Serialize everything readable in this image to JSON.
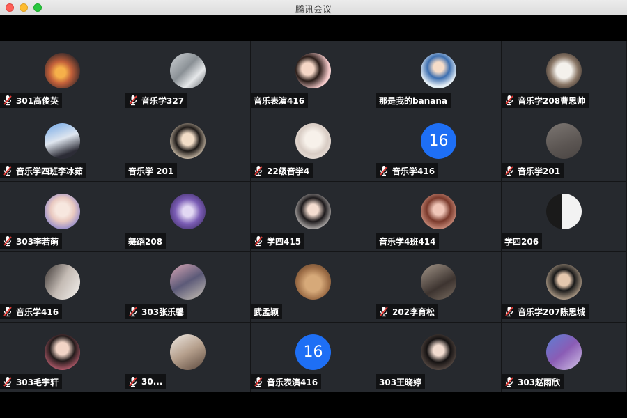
{
  "window": {
    "title": "腾讯会议"
  },
  "participants": [
    {
      "name": "301高俊英",
      "muted": true,
      "avatar": "photo-sunset"
    },
    {
      "name": "音乐学327",
      "muted": true,
      "avatar": "photo-robot"
    },
    {
      "name": "音乐表演416",
      "muted": false,
      "avatar": "photo-cartoon-pair"
    },
    {
      "name": "那是我的banana",
      "muted": false,
      "avatar": "photo-anime-girl-book"
    },
    {
      "name": "音乐学208曹思帅",
      "muted": true,
      "avatar": "photo-dog"
    },
    {
      "name": "音乐学四班李冰茹",
      "muted": true,
      "avatar": "photo-girl-blue-sky"
    },
    {
      "name": "音乐学 201",
      "muted": false,
      "avatar": "photo-girl-ears"
    },
    {
      "name": "22级音学4",
      "muted": true,
      "avatar": "photo-sketch-girl"
    },
    {
      "name": "音乐学416",
      "muted": true,
      "avatar": "16"
    },
    {
      "name": "音乐学201",
      "muted": true,
      "avatar": "photo-grey-couple"
    },
    {
      "name": "303李若萌",
      "muted": true,
      "avatar": "photo-anime-blonde"
    },
    {
      "name": "舞蹈208",
      "muted": false,
      "avatar": "photo-purple-anime"
    },
    {
      "name": "学四415",
      "muted": true,
      "avatar": "photo-anime-boy"
    },
    {
      "name": "音乐学4班414",
      "muted": false,
      "avatar": "photo-girl-sunglasses"
    },
    {
      "name": "学四206",
      "muted": false,
      "avatar": "photo-bw-silhouette"
    },
    {
      "name": "音乐学416",
      "muted": true,
      "avatar": "photo-boy-window"
    },
    {
      "name": "303张乐馨",
      "muted": true,
      "avatar": "photo-girl-costume"
    },
    {
      "name": "武孟颖",
      "muted": false,
      "avatar": "photo-teddy-bears"
    },
    {
      "name": "202李育松",
      "muted": true,
      "avatar": "photo-boy-piano"
    },
    {
      "name": "音乐学207陈思城",
      "muted": true,
      "avatar": "photo-man-sunglasses"
    },
    {
      "name": "303毛宇轩",
      "muted": true,
      "avatar": "photo-girl-pink"
    },
    {
      "name": "30...",
      "muted": true,
      "avatar": "photo-room-figure"
    },
    {
      "name": "音乐表演416",
      "muted": true,
      "avatar": "16"
    },
    {
      "name": "303王晓婷",
      "muted": false,
      "avatar": "photo-girl-dark-hair"
    },
    {
      "name": "303赵雨欣",
      "muted": true,
      "avatar": "photo-purple-bed"
    }
  ],
  "colors": {
    "tile_bg": "#26292e",
    "number_avatar_bg": "#1e6ff5",
    "mute_icon": "#ffffff",
    "mute_slash": "#e53935"
  }
}
